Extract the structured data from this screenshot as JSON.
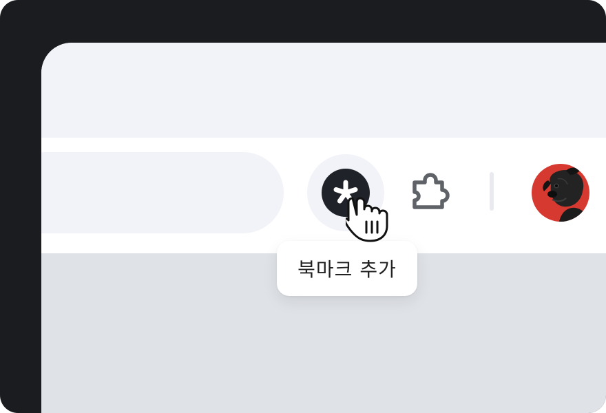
{
  "toolbar": {
    "bookmark_button": {
      "glyph": "*"
    },
    "tooltip": {
      "text": "북마크 추가"
    }
  },
  "icons": {
    "bookmark": "asterisk-icon",
    "extensions": "puzzle-piece-icon",
    "profile": "profile-avatar",
    "cursor": "hand-pointer-cursor"
  },
  "colors": {
    "frame": "#1b1c1f",
    "tab_strip": "#f1f3f8",
    "toolbar": "#ffffff",
    "content": "#dfe2e7",
    "bookmark_disc": "#1f2228",
    "avatar_bg": "#d6392f"
  }
}
